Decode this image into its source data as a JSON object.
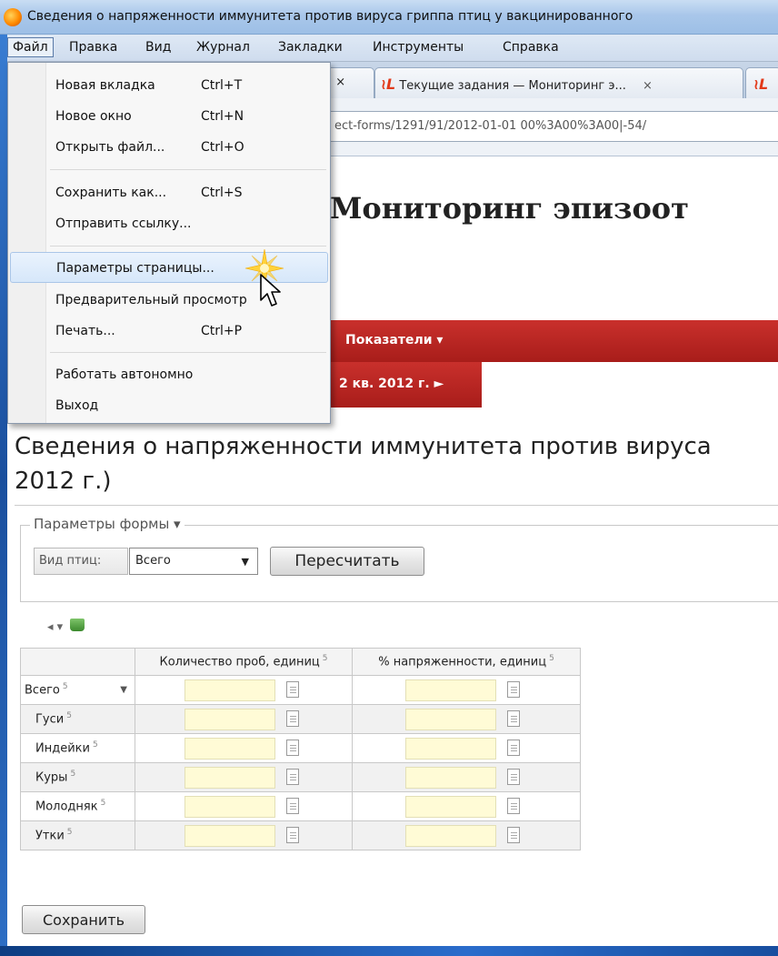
{
  "window": {
    "title": "Сведения о напряженности иммунитета против вируса гриппа птиц у вакцинированного"
  },
  "menubar": {
    "items": [
      "Файл",
      "Правка",
      "Вид",
      "Журнал",
      "Закладки",
      "Инструменты",
      "Справка"
    ]
  },
  "tabs": [
    {
      "label": ". ×"
    },
    {
      "label": "Текущие задания — Мониторинг э...",
      "close": "×"
    },
    {
      "label": ""
    }
  ],
  "urlbar": {
    "value": "ect-forms/1291/91/2012-01-01 00%3A00%3A00|-54/"
  },
  "file_menu": {
    "items": [
      {
        "label": "Новая вкладка",
        "shortcut": "Ctrl+T"
      },
      {
        "label": "Новое окно",
        "shortcut": "Ctrl+N"
      },
      {
        "label": "Открыть файл...",
        "shortcut": "Ctrl+O"
      },
      {
        "label": "Сохранить как...",
        "shortcut": "Ctrl+S"
      },
      {
        "label": "Отправить ссылку...",
        "shortcut": ""
      },
      {
        "label": "Параметры страницы...",
        "shortcut": ""
      },
      {
        "label": "Предварительный просмотр",
        "shortcut": ""
      },
      {
        "label": "Печать...",
        "shortcut": "Ctrl+P"
      },
      {
        "label": "Работать автономно",
        "shortcut": ""
      },
      {
        "label": "Выход",
        "shortcut": ""
      }
    ],
    "highlighted_index": 5
  },
  "site": {
    "header": "Мониторинг эпизоот",
    "nav_label": "Показатели ▾",
    "period_tab": "2 кв. 2012 г. ►"
  },
  "form": {
    "heading_line1": "Сведения о напряженности иммунитета против вируса",
    "heading_line2": "2012 г.)",
    "params_legend": "Параметры формы ▾",
    "bird_type_label": "Вид птиц:",
    "bird_type_value": "Всего",
    "recalc_button": "Пересчитать",
    "save_button": "Сохранить"
  },
  "toolbar": {
    "back_arrow": "◂",
    "menu_arrow": "▾"
  },
  "table": {
    "columns": [
      "",
      "Количество проб, единиц",
      "% напряженности, единиц"
    ],
    "superscript": "5",
    "rows": [
      {
        "label": "Всего",
        "has_arrow": true
      },
      {
        "label": "Гуси"
      },
      {
        "label": "Индейки"
      },
      {
        "label": "Куры"
      },
      {
        "label": "Молодняк"
      },
      {
        "label": "Утки"
      }
    ]
  },
  "colors": {
    "accent_red": "#b32420",
    "input_bg": "#fffbd6",
    "menu_hover": "#d6e7fa"
  }
}
